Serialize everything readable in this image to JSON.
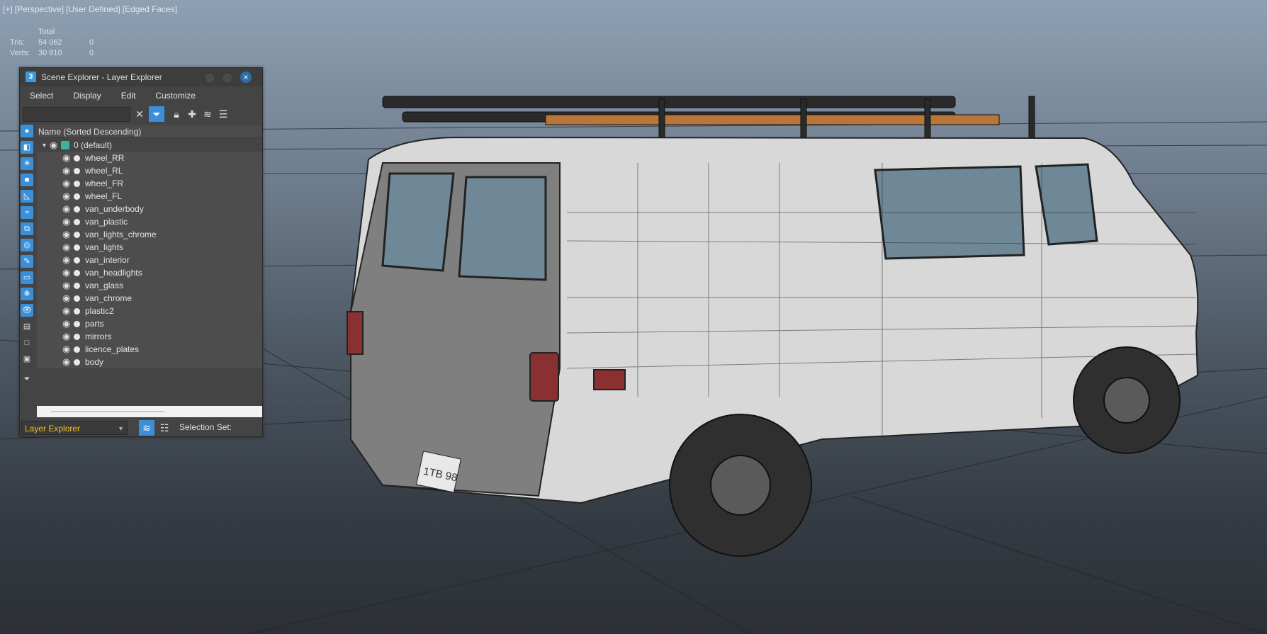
{
  "viewport": {
    "label_parts": [
      "[+]",
      "[Perspective]",
      "[User Defined]",
      "[Edged Faces]"
    ],
    "stats": {
      "header": "Total",
      "rows": [
        {
          "label": "Tris:",
          "total": "54 062",
          "sel": "0"
        },
        {
          "label": "Verts:",
          "total": "30 810",
          "sel": "0"
        }
      ]
    },
    "license_plate": "1TB 98"
  },
  "explorer": {
    "title": "Scene Explorer - Layer Explorer",
    "app_icon": "3",
    "menu": [
      "Select",
      "Display",
      "Edit",
      "Customize"
    ],
    "column_header": "Name (Sorted Descending)",
    "root_layer": "0 (default)",
    "layers": [
      "wheel_RR",
      "wheel_RL",
      "wheel_FR",
      "wheel_FL",
      "van_underbody",
      "van_plastic",
      "van_lights_chrome",
      "van_lights",
      "van_interior",
      "van_headlights",
      "van_glass",
      "van_chrome",
      "plastic2",
      "parts",
      "mirrors",
      "licence_plates",
      "body"
    ],
    "explorer_mode": "Layer Explorer",
    "selection_set_label": "Selection Set:",
    "icons": {
      "close": "close-icon",
      "filter": "filter-icon",
      "lock": "lock-icon",
      "visibility": "eye-icon"
    },
    "accent": "#3a8fd9",
    "dropdown_text_color": "#f0c020"
  }
}
